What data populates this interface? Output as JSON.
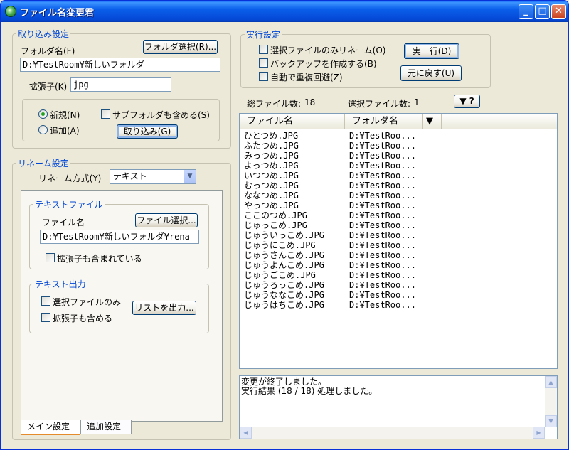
{
  "window": {
    "title": "ファイル名変更君"
  },
  "import_settings": {
    "group_label": "取り込み設定",
    "folder_label": "フォルダ名(F)",
    "folder_select_button": "フォルダ選択(R)...",
    "folder_value": "D:¥TestRoom¥新しいフォルダ",
    "ext_label": "拡張子(K)",
    "ext_value": "jpg",
    "radio_new": "新規(N)",
    "radio_add": "追加(A)",
    "subfolder_check": "サブフォルダも含める(S)",
    "import_button": "取り込み(G)"
  },
  "rename_settings": {
    "group_label": "リネーム設定",
    "method_label": "リネーム方式(Y)",
    "method_value": "テキスト",
    "text_file": {
      "group_label": "テキストファイル",
      "file_label": "ファイル名",
      "file_select_button": "ファイル選択...",
      "file_value": "D:¥TestRoom¥新しいフォルダ¥rena",
      "ext_included_check": "拡張子も含まれている"
    },
    "text_output": {
      "group_label": "テキスト出力",
      "selected_only_check": "選択ファイルのみ",
      "include_ext_check": "拡張子も含める",
      "output_list_button": "リストを出力..."
    }
  },
  "execute_settings": {
    "group_label": "実行設定",
    "rename_selected_check": "選択ファイルのみリネーム(O)",
    "backup_check": "バックアップを作成する(B)",
    "auto_avoid_check": "自動で重複回避(Z)",
    "run_button": "実　行(D)",
    "revert_button": "元に戻す(U)"
  },
  "stats": {
    "total_label": "総ファイル数:",
    "total_value": "18",
    "selected_label": "選択ファイル数:",
    "selected_value": "1",
    "menu_button": "▼ ?"
  },
  "file_list": {
    "columns": [
      "ファイル名",
      "フォルダ名"
    ],
    "rows": [
      [
        "ひとつめ.JPG",
        "D:¥TestRoo..."
      ],
      [
        "ふたつめ.JPG",
        "D:¥TestRoo..."
      ],
      [
        "みっつめ.JPG",
        "D:¥TestRoo..."
      ],
      [
        "よっつめ.JPG",
        "D:¥TestRoo..."
      ],
      [
        "いつつめ.JPG",
        "D:¥TestRoo..."
      ],
      [
        "むっつめ.JPG",
        "D:¥TestRoo..."
      ],
      [
        "ななつめ.JPG",
        "D:¥TestRoo..."
      ],
      [
        "やっつめ.JPG",
        "D:¥TestRoo..."
      ],
      [
        "ここのつめ.JPG",
        "D:¥TestRoo..."
      ],
      [
        "じゅっこめ.JPG",
        "D:¥TestRoo..."
      ],
      [
        "じゅういっこめ.JPG",
        "D:¥TestRoo..."
      ],
      [
        "じゅうにこめ.JPG",
        "D:¥TestRoo..."
      ],
      [
        "じゅうさんこめ.JPG",
        "D:¥TestRoo..."
      ],
      [
        "じゅうよんこめ.JPG",
        "D:¥TestRoo..."
      ],
      [
        "じゅうごこめ.JPG",
        "D:¥TestRoo..."
      ],
      [
        "じゅうろっこめ.JPG",
        "D:¥TestRoo..."
      ],
      [
        "じゅうななこめ.JPG",
        "D:¥TestRoo..."
      ],
      [
        "じゅうはちこめ.JPG",
        "D:¥TestRoo..."
      ]
    ]
  },
  "log": {
    "lines": [
      "変更が終了しました。",
      "実行結果 (18 / 18) 処理しました。"
    ]
  },
  "tabs": [
    "メイン設定",
    "追加設定"
  ],
  "colors": {
    "group_label": "#0046d5",
    "titlebar": "#0548d6",
    "tab_active": "#e68b2c"
  }
}
